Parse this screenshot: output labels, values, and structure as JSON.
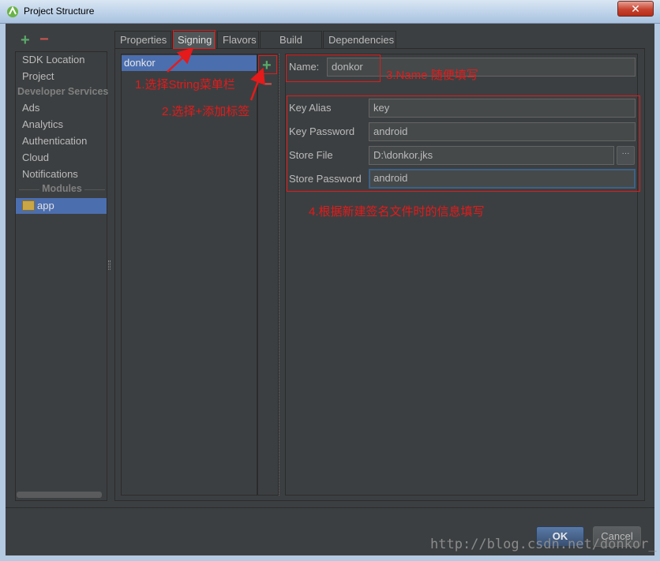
{
  "window": {
    "title": "Project Structure",
    "close_label": "✕"
  },
  "left_toolbar": {
    "add_label": "+",
    "remove_label": "−"
  },
  "sidebar": {
    "items": [
      "SDK Location",
      "Project"
    ],
    "developer_services_header": "Developer Services",
    "services": [
      "Ads",
      "Analytics",
      "Authentication",
      "Cloud",
      "Notifications"
    ],
    "modules_header": "Modules",
    "module": "app"
  },
  "tabs": [
    "Properties",
    "Signing",
    "Flavors",
    "Build Types",
    "Dependencies"
  ],
  "active_tab": "Signing",
  "config_list": {
    "items": [
      "donkor"
    ],
    "add_label": "+",
    "remove_label": "−"
  },
  "form": {
    "name_label": "Name:",
    "name_value": "donkor",
    "key_alias_label": "Key Alias",
    "key_alias_value": "key",
    "key_password_label": "Key Password",
    "key_password_value": "android",
    "store_file_label": "Store File",
    "store_file_value": "D:\\donkor.jks",
    "browse_label": "···",
    "store_password_label": "Store Password",
    "store_password_value": "android"
  },
  "annotations": {
    "note1": "1.选择String菜单栏",
    "note2": "2.选择+添加标签",
    "note3": "3.Name 随便填写",
    "note4": "4.根据新建签名文件时的信息填写"
  },
  "buttons": {
    "ok": "OK",
    "cancel": "Cancel"
  },
  "watermark": "http://blog.csdn.net/donkor_",
  "colors": {
    "accent": "#4b6eaf",
    "annotation": "#e51a1a",
    "add": "#59a869",
    "remove": "#c75450"
  }
}
